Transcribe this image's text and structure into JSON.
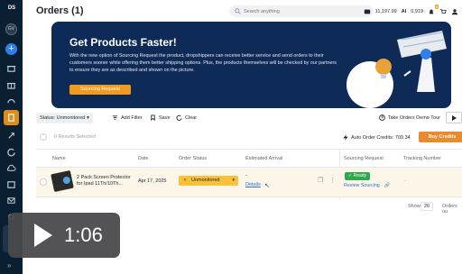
{
  "app": {
    "logo_text": "DS"
  },
  "sidebar": {
    "avatar_text": "GV"
  },
  "header": {
    "title": "Orders (1)",
    "search_placeholder": "Search anything",
    "balance": "11,197.99",
    "points": "0,919"
  },
  "banner": {
    "title": "Get Products Faster!",
    "text": "With the new option of Sourcing Request the product, dropshippers can receive better service and send orders to their customers sooner while offering them better shipping options. Plus, the products themselves will be checked by our partners to ensure they are as described and shown on the picture.",
    "button": "Sourcing Request"
  },
  "toolbar": {
    "status_filter": "Status: Unmonitored",
    "add_filter": "Add Filter",
    "save": "Save",
    "clear": "Clear",
    "tour": "Take Orders Demo Tour"
  },
  "selection": {
    "selected_text": "0 Results Selected",
    "credits": "Auto Order Credits: 709.34",
    "buy_button": "Buy Credits"
  },
  "table": {
    "columns": [
      "Name",
      "Date",
      "Order Status",
      "Estimated Arrival",
      "Sourcing Request",
      "Tracking Number"
    ],
    "rows": [
      {
        "name": "2 Pack Screen Protector for Ipad 11Th/10Th...",
        "date": "Apr 17, 2025",
        "status": "Unmonitored",
        "arrival": "-",
        "details": "Details",
        "sourcing_status": "Ready",
        "review": "Review Sourcing",
        "tracking": "-"
      }
    ]
  },
  "footer": {
    "show_label": "Show",
    "page_size": "20",
    "orders_label": "Orders ou"
  },
  "video_overlay": {
    "time": "1:06"
  },
  "colors": {
    "accent": "#f29a1d",
    "banner_bg": "#0e2a56",
    "sidebar_bg": "#0b1f33",
    "status_yellow": "#f7c23a",
    "ready_green": "#2fa84f"
  }
}
